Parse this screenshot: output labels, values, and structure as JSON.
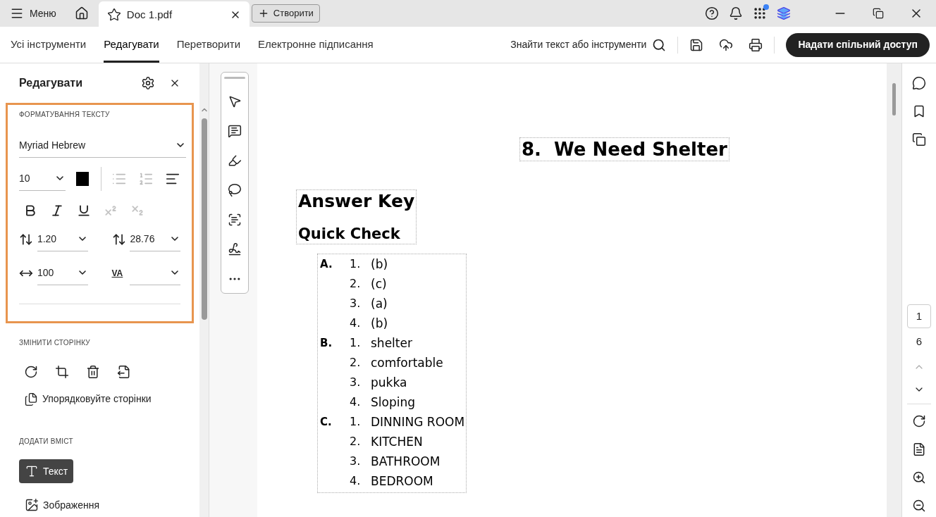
{
  "titlebar": {
    "menu": "Меню",
    "tab": {
      "title": "Doc 1.pdf",
      "selected": true
    },
    "create": "Створити"
  },
  "nav_tabs": [
    {
      "label": "Усі інструменти",
      "selected": false
    },
    {
      "label": "Редагувати",
      "selected": true
    },
    {
      "label": "Перетворити",
      "selected": false
    },
    {
      "label": "Електронне підписання",
      "selected": false
    }
  ],
  "search": {
    "label": "Знайти текст або інструменти"
  },
  "share_button": "Надати спільний доступ",
  "panel": {
    "title": "Редагувати",
    "text_format": {
      "heading": "ФОРМАТУВАННЯ ТЕКСТУ",
      "font": "Myriad Hebrew",
      "size": "10",
      "color": "#000000",
      "list_buttons": [
        {
          "kind": "bullets",
          "disabled": true
        },
        {
          "kind": "numbered",
          "disabled": true
        },
        {
          "kind": "align",
          "disabled": false
        }
      ],
      "style_buttons": [
        {
          "kind": "bold",
          "disabled": false
        },
        {
          "kind": "italic",
          "disabled": false
        },
        {
          "kind": "underline",
          "disabled": false
        },
        {
          "kind": "superscript",
          "disabled": true
        },
        {
          "kind": "subscript",
          "disabled": true
        }
      ],
      "line_spacing": "1.20",
      "paragraph_spacing": "28.76",
      "horizontal_scale": "100",
      "tracking_icon": "VA"
    },
    "page_section": {
      "heading": "ЗМІНИТИ СТОРІНКУ",
      "organize": "Упорядковуйте сторінки"
    },
    "add_section": {
      "heading": "ДОДАТИ ВМІСТ",
      "items": [
        {
          "kind": "text",
          "label": "Текст",
          "selected": true
        },
        {
          "kind": "image",
          "label": "Зображення",
          "selected": false
        }
      ]
    }
  },
  "document": {
    "title": "8.  We Need Shelter",
    "heading": "Answer Key",
    "subheading": "Quick Check",
    "sections": [
      {
        "letter": "A.",
        "items": [
          {
            "number": "1.",
            "text": "(b)"
          },
          {
            "number": "2.",
            "text": "(c)"
          },
          {
            "number": "3.",
            "text": "(a)"
          },
          {
            "number": "4.",
            "text": "(b)"
          }
        ]
      },
      {
        "letter": "B.",
        "items": [
          {
            "number": "1.",
            "text": "shelter"
          },
          {
            "number": "2.",
            "text": "comfortable"
          },
          {
            "number": "3.",
            "text": "pukka"
          },
          {
            "number": "4.",
            "text": "Sloping"
          }
        ]
      },
      {
        "letter": "C.",
        "items": [
          {
            "number": "1.",
            "text": "DINNING ROOM"
          },
          {
            "number": "2.",
            "text": "KITCHEN"
          },
          {
            "number": "3.",
            "text": "BATHROOM"
          },
          {
            "number": "4.",
            "text": "BEDROOM"
          }
        ]
      }
    ]
  },
  "page_nav": {
    "current": "1",
    "total": "6"
  }
}
